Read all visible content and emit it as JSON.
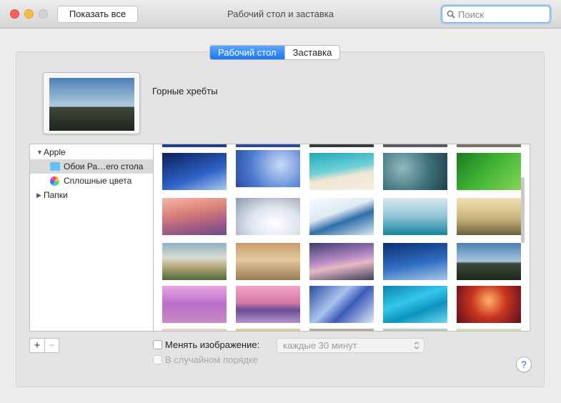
{
  "window": {
    "title": "Рабочий стол и заставка",
    "show_all_label": "Показать все",
    "search_placeholder": "Поиск"
  },
  "tabs": [
    {
      "label": "Рабочий стол",
      "active": true
    },
    {
      "label": "Заставка",
      "active": false
    }
  ],
  "current_picture": {
    "name": "Горные хребты"
  },
  "source_list": {
    "group_apple": "Apple",
    "item_wallpapers": "Обои Ра…его стола",
    "item_solid_colors": "Сплошные цвета",
    "group_folders": "Папки"
  },
  "controls": {
    "change_picture_label": "Менять изображение:",
    "change_interval": "каждые 30 минут",
    "random_order_label": "В случайном порядке",
    "add_label": "+",
    "remove_label": "−",
    "help_label": "?"
  },
  "colors": {
    "accent": "#1a78f0",
    "close": "#fc605b",
    "minimize": "#fdbc40"
  }
}
